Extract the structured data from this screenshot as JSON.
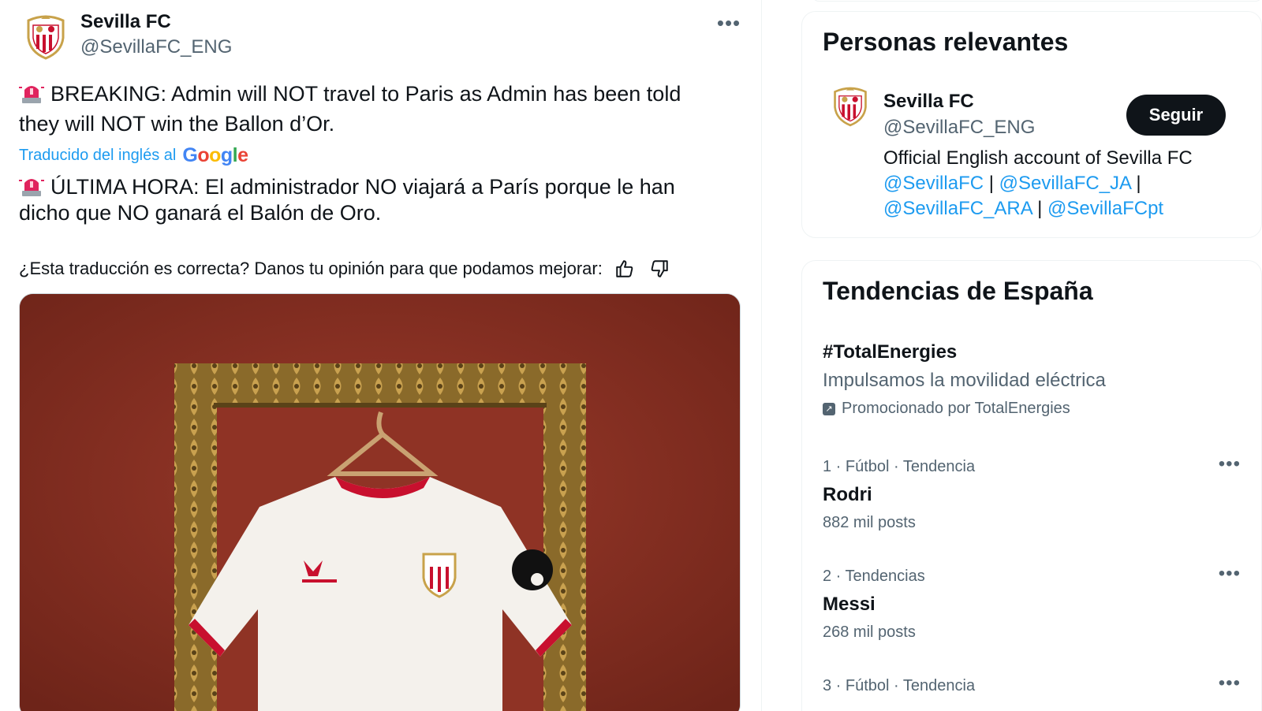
{
  "tweet": {
    "author_name": "Sevilla FC",
    "author_handle": "@SevillaFC_ENG",
    "more_icon": "more-horizontal-icon",
    "text_line1": "BREAKING: Admin will NOT travel to Paris as Admin has been told",
    "text_line2": "they will NOT win the Ballon d’Or.",
    "translated_by": "Traducido del inglés al",
    "google_brand": {
      "G": "G",
      "o1": "o",
      "o2": "o",
      "g": "g",
      "l": "l",
      "e": "e"
    },
    "translation_line1": "ÚLTIMA HORA: El administrador NO viajará a París porque le han",
    "translation_line2": "dicho que NO ganará el Balón de Oro.",
    "feedback_prompt": "¿Esta traducción es correcta? Danos tu opinión para que podamos mejorar:",
    "thumbs_up_icon": "thumbs-up-icon",
    "thumbs_down_icon": "thumbs-down-icon",
    "media_description_icon": "photo-jersey"
  },
  "sidebar": {
    "relevant": {
      "title": "Personas relevantes",
      "name": "Sevilla FC",
      "handle": "@SevillaFC_ENG",
      "follow_label": "Seguir",
      "bio_text": "Official English account of Sevilla FC",
      "bio_links": [
        "@SevillaFC",
        "@SevillaFC_JA",
        "@SevillaFC_ARA",
        "@SevillaFCpt"
      ],
      "separator": "|"
    },
    "trends": {
      "title": "Tendencias de España",
      "ad": {
        "hashtag": "#TotalEnergies",
        "description": "Impulsamos la movilidad eléctrica",
        "promoted_by": "Promocionado por TotalEnergies"
      },
      "items": [
        {
          "meta": "1 · Fútbol · Tendencia",
          "name": "Rodri",
          "count": "882 mil posts"
        },
        {
          "meta": "2 · Tendencias",
          "name": "Messi",
          "count": "268 mil posts"
        },
        {
          "meta": "3 · Fútbol · Tendencia",
          "name": "",
          "count": ""
        }
      ]
    }
  },
  "colors": {
    "accent": "#1d9bf0",
    "text_primary": "#0f1419",
    "text_secondary": "#536471",
    "button_dark": "#0f1419",
    "photo_wall": "#8d3326",
    "frame_gold": "#b08a3e"
  }
}
